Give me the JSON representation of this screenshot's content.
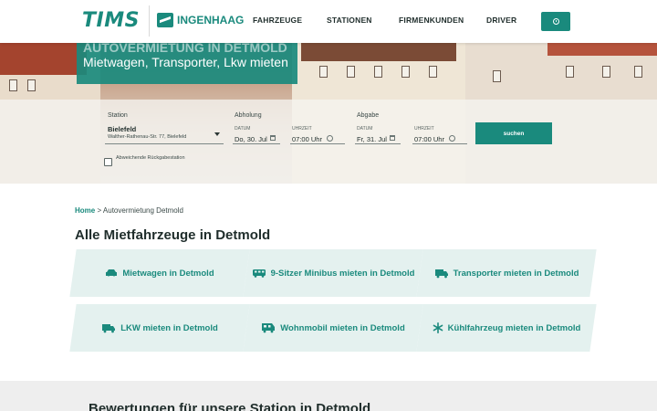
{
  "header": {
    "logo_tims": "TIMS",
    "logo_ingenhaag": "INGENHAAG",
    "nav": [
      "FAHRZEUGE",
      "STATIONEN",
      "FIRMENKUNDEN",
      "DRIVER"
    ],
    "user_icon": "user-icon",
    "accent_color": "#1a8a7d"
  },
  "hero": {
    "title": "AUTOVERMIETUNG IN DETMOLD",
    "subtitle": "Mietwagen, Transporter, Lkw mieten"
  },
  "search": {
    "station_label": "Station",
    "station_value": "Bielefeld",
    "station_address": "Walther-Rathenau-Str. 77, Bielefeld",
    "pickup_label": "Abholung",
    "pickup_date_label": "DATUM",
    "pickup_date": "Do, 30. Jul",
    "pickup_time_label": "UHRZEIT",
    "pickup_time": "07:00 Uhr",
    "return_label": "Abgabe",
    "return_date_label": "DATUM",
    "return_date": "Fr, 31. Jul",
    "return_time_label": "UHRZEIT",
    "return_time": "07:00 Uhr",
    "search_button": "suchen",
    "different_return_label": "Abweichende Rückgabestation"
  },
  "breadcrumb": {
    "home": "Home",
    "separator": " > ",
    "current": "Autovermietung Detmold"
  },
  "main": {
    "title": "Alle Mietfahrzeuge in Detmold",
    "tiles": [
      {
        "label": "Mietwagen in Detmold",
        "icon": "car-icon"
      },
      {
        "label": "9-Sitzer Minibus mieten in Detmold",
        "icon": "minibus-icon"
      },
      {
        "label": "Transporter mieten in Detmold",
        "icon": "van-icon"
      },
      {
        "label": "LKW mieten in Detmold",
        "icon": "truck-icon"
      },
      {
        "label": "Wohnmobil mieten in Detmold",
        "icon": "camper-icon"
      },
      {
        "label": "Kühlfahrzeug mieten in Detmold",
        "icon": "snowflake-icon"
      }
    ]
  },
  "reviews": {
    "title": "Bewertungen für unsere Station in Detmold"
  }
}
